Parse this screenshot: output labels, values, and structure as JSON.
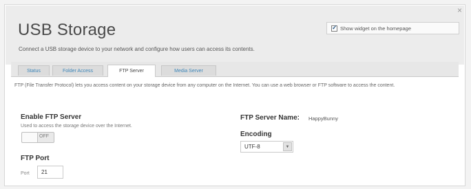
{
  "panel": {
    "close_icon": "×",
    "title": "USB Storage",
    "subtitle": "Connect a USB storage device to your network and configure how users can access its contents.",
    "show_widget": {
      "label": "Show widget on the homepage",
      "checked": true
    }
  },
  "tabs": [
    {
      "label": "Status",
      "active": false
    },
    {
      "label": "Folder Access",
      "active": false
    },
    {
      "label": "FTP Server",
      "active": true
    },
    {
      "label": "Media Server",
      "active": false
    }
  ],
  "ftp": {
    "intro": "FTP (File Transfer Protocol) lets you access content on your storage device from any computer on the Internet. You can use a web browser or FTP software to access the content.",
    "enable_label": "Enable FTP Server",
    "enable_helper": "Used to access the storage device over the Internet.",
    "toggle_state": "OFF",
    "port_section_label": "FTP Port",
    "port_label": "Port",
    "port_value": "21",
    "server_name_label": "FTP Server Name:",
    "server_name_value": "HappyBunny",
    "encoding_label": "Encoding",
    "encoding_value": "UTF-8"
  },
  "colors": {
    "tab_link": "#3d86b9",
    "header_bg": "#ececec",
    "checkbox_check": "#2f5e8a"
  }
}
